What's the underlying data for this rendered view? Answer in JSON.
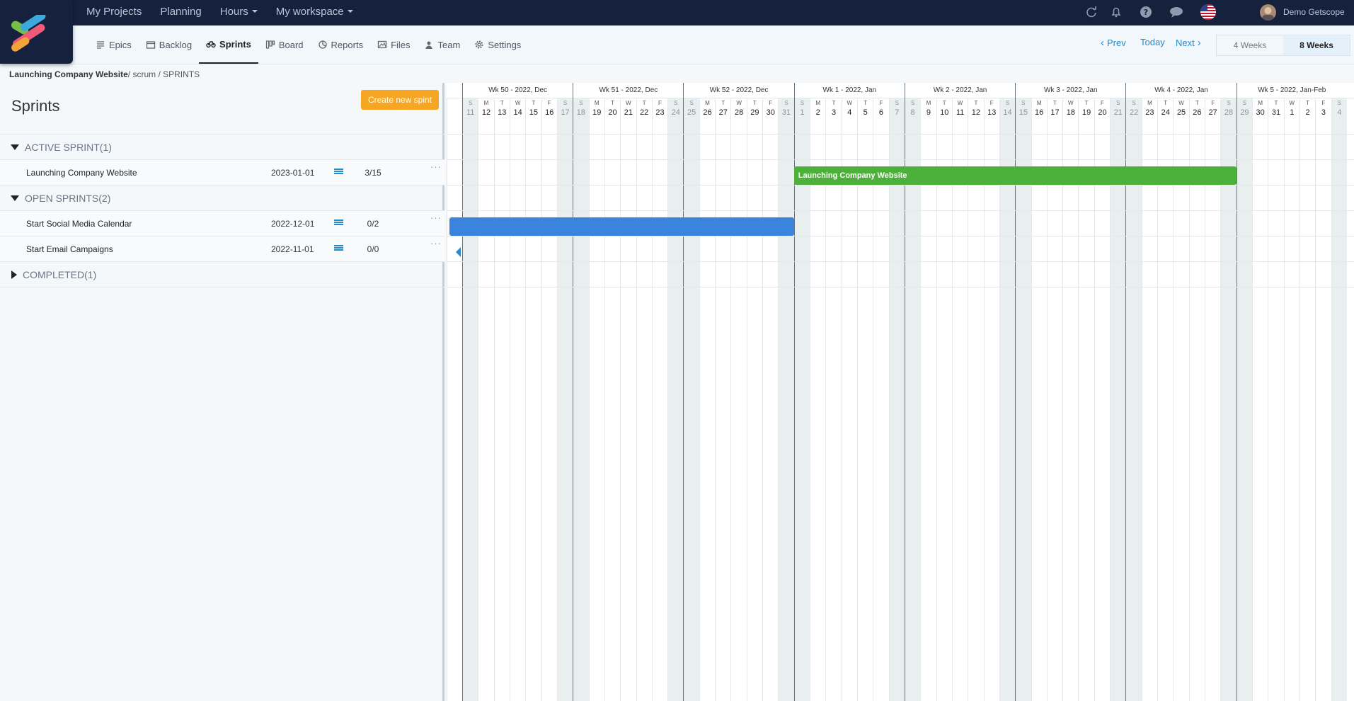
{
  "topnav": {
    "items": [
      {
        "label": "My Projects",
        "caret": false
      },
      {
        "label": "Planning",
        "caret": false
      },
      {
        "label": "Hours",
        "caret": true
      },
      {
        "label": "My workspace",
        "caret": true
      }
    ],
    "user_name": "Demo Getscope"
  },
  "tabs": [
    {
      "label": "Epics",
      "icon": "epics-icon",
      "active": false
    },
    {
      "label": "Backlog",
      "icon": "backlog-icon",
      "active": false
    },
    {
      "label": "Sprints",
      "icon": "sprints-icon",
      "active": true
    },
    {
      "label": "Board",
      "icon": "board-icon",
      "active": false
    },
    {
      "label": "Reports",
      "icon": "reports-icon",
      "active": false
    },
    {
      "label": "Files",
      "icon": "files-icon",
      "active": false
    },
    {
      "label": "Team",
      "icon": "team-icon",
      "active": false
    },
    {
      "label": "Settings",
      "icon": "settings-icon",
      "active": false
    }
  ],
  "timeline_nav": {
    "prev": "Prev",
    "today": "Today",
    "next": "Next",
    "weeks4": "4 Weeks",
    "weeks8": "8 Weeks"
  },
  "breadcrumb": {
    "project": "Launching Company Website",
    "rest": "/ scrum / SPRINTS"
  },
  "panel": {
    "title": "Sprints",
    "create_button": "Create new spint",
    "groups": {
      "active": "ACTIVE SPRINT(1)",
      "open": "OPEN SPRINTS(2)",
      "completed": "COMPLETED(1)"
    },
    "sprints": [
      {
        "name": "Launching Company Website",
        "date": "2023-01-01",
        "count": "3/15"
      },
      {
        "name": "Start Social Media Calendar",
        "date": "2022-12-01",
        "count": "0/2"
      },
      {
        "name": "Start Email Campaigns",
        "date": "2022-11-01",
        "count": "0/0"
      }
    ],
    "more": "···"
  },
  "timeline": {
    "weeks": [
      "Wk 50 - 2022, Dec",
      "Wk 51 - 2022, Dec",
      "Wk 52 - 2022, Dec",
      "Wk 1 - 2022, Jan",
      "Wk 2 - 2022, Jan",
      "Wk 3 - 2022, Jan",
      "Wk 4 - 2022, Jan",
      "Wk 5 - 2022, Jan-Feb"
    ],
    "day_letters": [
      "S",
      "M",
      "T",
      "W",
      "T",
      "F",
      "S"
    ],
    "days": [
      11,
      12,
      13,
      14,
      15,
      16,
      17,
      18,
      19,
      20,
      21,
      22,
      23,
      24,
      25,
      26,
      27,
      28,
      29,
      30,
      31,
      1,
      2,
      3,
      4,
      5,
      6,
      7,
      8,
      9,
      10,
      11,
      12,
      13,
      14,
      15,
      16,
      17,
      18,
      19,
      20,
      21,
      22,
      23,
      24,
      25,
      26,
      27,
      28,
      29,
      30,
      31,
      1,
      2,
      3,
      4
    ],
    "bars": [
      {
        "label": "Launching Company Website",
        "color": "#4db03a"
      },
      {
        "label": "",
        "color": "#3a84de"
      }
    ]
  },
  "colors": {
    "topbar": "#16213d",
    "accent": "#2a8ac8",
    "create": "#f6a623"
  }
}
